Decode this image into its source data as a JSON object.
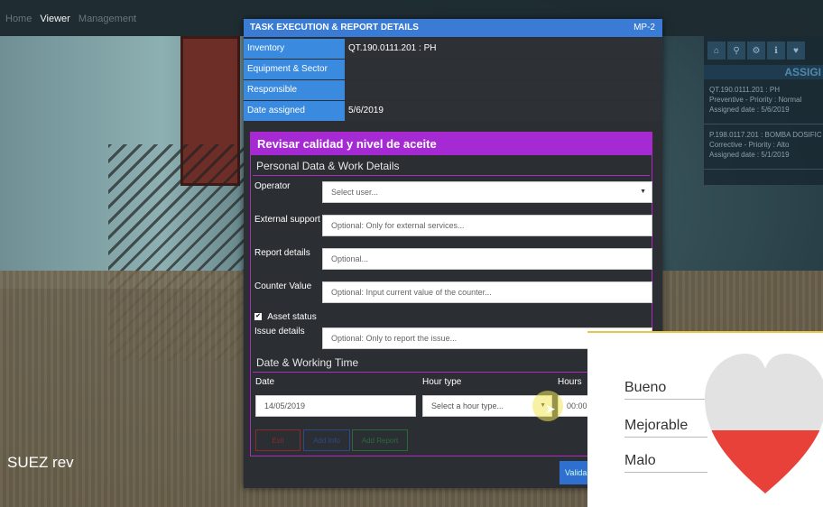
{
  "nav": {
    "items": [
      "Home",
      "Viewer",
      "Management"
    ],
    "active": "Viewer"
  },
  "right_panel": {
    "icons": [
      "home-icon",
      "search-icon",
      "settings-icon",
      "info-icon",
      "heart-icon"
    ],
    "header": "ASSIGI",
    "tasks": [
      {
        "title": "QT.190.0111.201 : PH",
        "type": "Preventive - Priority : Normal",
        "date": "Assigned date : 5/6/2019"
      },
      {
        "title": "P.198.0117.201 : BOMBA DOSIFIC",
        "type": "Corrective - Priority : Alto",
        "date": "Assigned date : 5/1/2019"
      }
    ]
  },
  "scene_caption": "SUEZ rev",
  "modal": {
    "title": "TASK EXECUTION & REPORT DETAILS",
    "code": "MP-2",
    "info": [
      {
        "label": "Inventory",
        "value": "QT.190.0111.201 : PH"
      },
      {
        "label": "Equipment & Sector",
        "value": ""
      },
      {
        "label": "Responsible",
        "value": ""
      },
      {
        "label": "Date assigned",
        "value": "5/6/2019"
      }
    ],
    "form_title": "Revisar calidad y nivel de aceite",
    "section_personal": "Personal Data & Work Details",
    "fields": {
      "operator": {
        "label": "Operator",
        "placeholder": "Select user..."
      },
      "external": {
        "label": "External support",
        "placeholder": "Optional: Only for external services..."
      },
      "report": {
        "label": "Report details",
        "placeholder": "Optional..."
      },
      "counter": {
        "label": "Counter Value",
        "placeholder": "Optional: Input current value of the counter..."
      },
      "asset_status": {
        "label": "Asset status",
        "checked": true
      },
      "issue": {
        "label": "Issue details",
        "placeholder": "Optional: Only to report the issue..."
      }
    },
    "section_date": "Date & Working Time",
    "date_labels": {
      "date": "Date",
      "hour_type": "Hour type",
      "hours": "Hours"
    },
    "date_values": {
      "date": "14/05/2019",
      "hour_type": "Select a hour type...",
      "hours": "00:00"
    },
    "buttons": {
      "exit": "Exit",
      "add_info": "Add Info",
      "add_report": "Add Report",
      "validate": "Valida"
    }
  },
  "rating": {
    "items": [
      "Bueno",
      "Mejorable",
      "Malo"
    ],
    "colors": {
      "top": "#e2e2e2",
      "bottom": "#e8413a"
    }
  }
}
